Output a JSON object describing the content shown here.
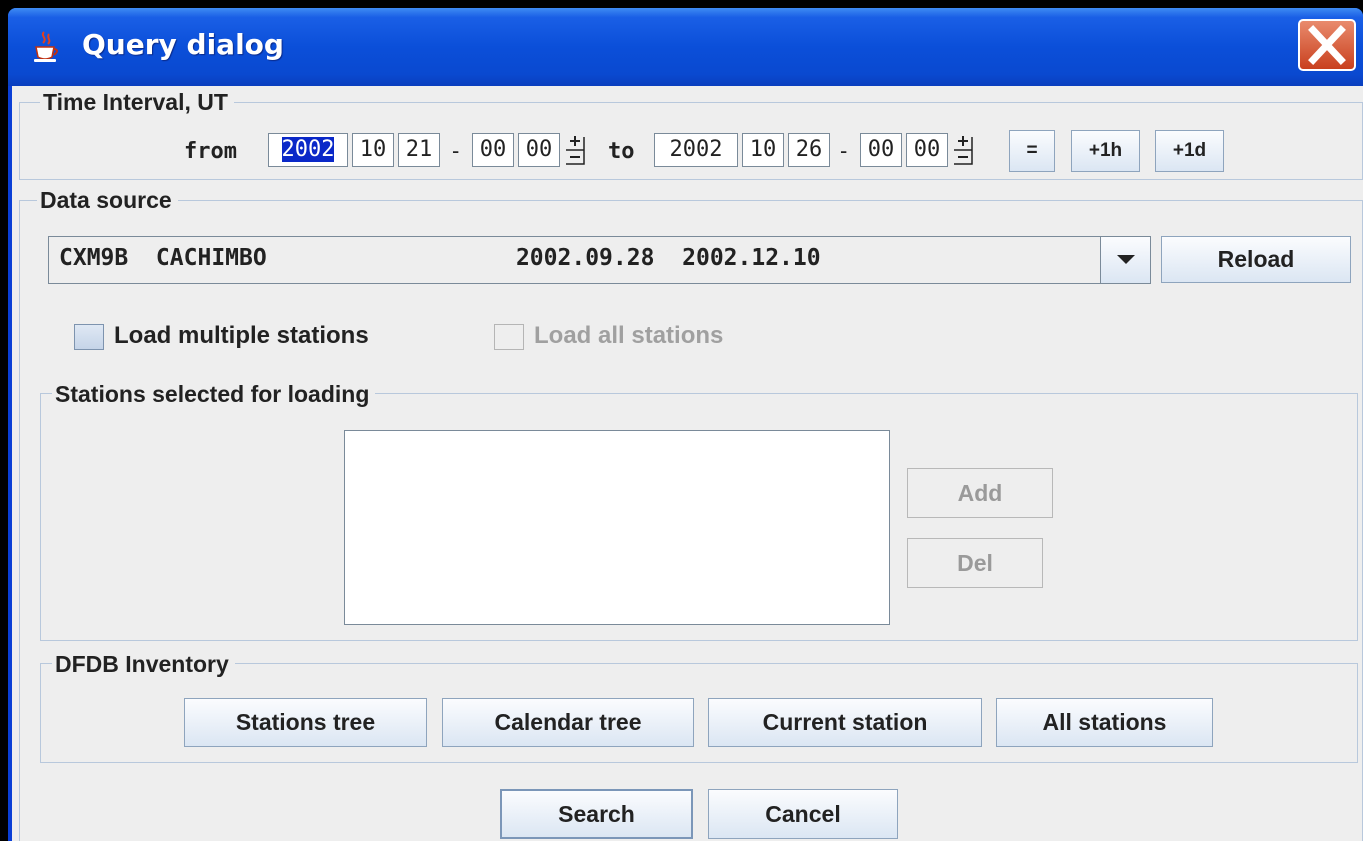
{
  "window": {
    "title": "Query dialog",
    "icons": {
      "app": "java-cup-icon",
      "close": "close-x-icon"
    }
  },
  "time_interval": {
    "legend": "Time Interval, UT",
    "from_label": "from",
    "from": {
      "year": "2002",
      "month": "10",
      "day": "21",
      "hour": "00",
      "minute": "00"
    },
    "dash": "-",
    "to_label": "to",
    "to": {
      "year": "2002",
      "month": "10",
      "day": "26",
      "hour": "00",
      "minute": "00"
    },
    "buttons": {
      "equal": "=",
      "plus_hour": "+1h",
      "plus_day": "+1d"
    }
  },
  "data_source": {
    "legend": "Data source",
    "selected": "CXM9B  CACHIMBO                  2002.09.28  2002.12.10",
    "reload_label": "Reload",
    "load_multiple_label": "Load multiple stations",
    "load_multiple_checked": false,
    "load_all_label": "Load all stations",
    "load_all_checked": false,
    "load_all_enabled": false
  },
  "stations_selected": {
    "legend": "Stations selected for loading",
    "items": [],
    "add_label": "Add",
    "del_label": "Del"
  },
  "inventory": {
    "legend": "DFDB Inventory",
    "buttons": [
      "Stations tree",
      "Calendar tree",
      "Current station",
      "All stations"
    ]
  },
  "footer": {
    "search_label": "Search",
    "cancel_label": "Cancel"
  },
  "colors": {
    "titlebar": "#0b4fd9",
    "selection": "#0a28c8",
    "dialog_bg": "#eeeeee"
  }
}
